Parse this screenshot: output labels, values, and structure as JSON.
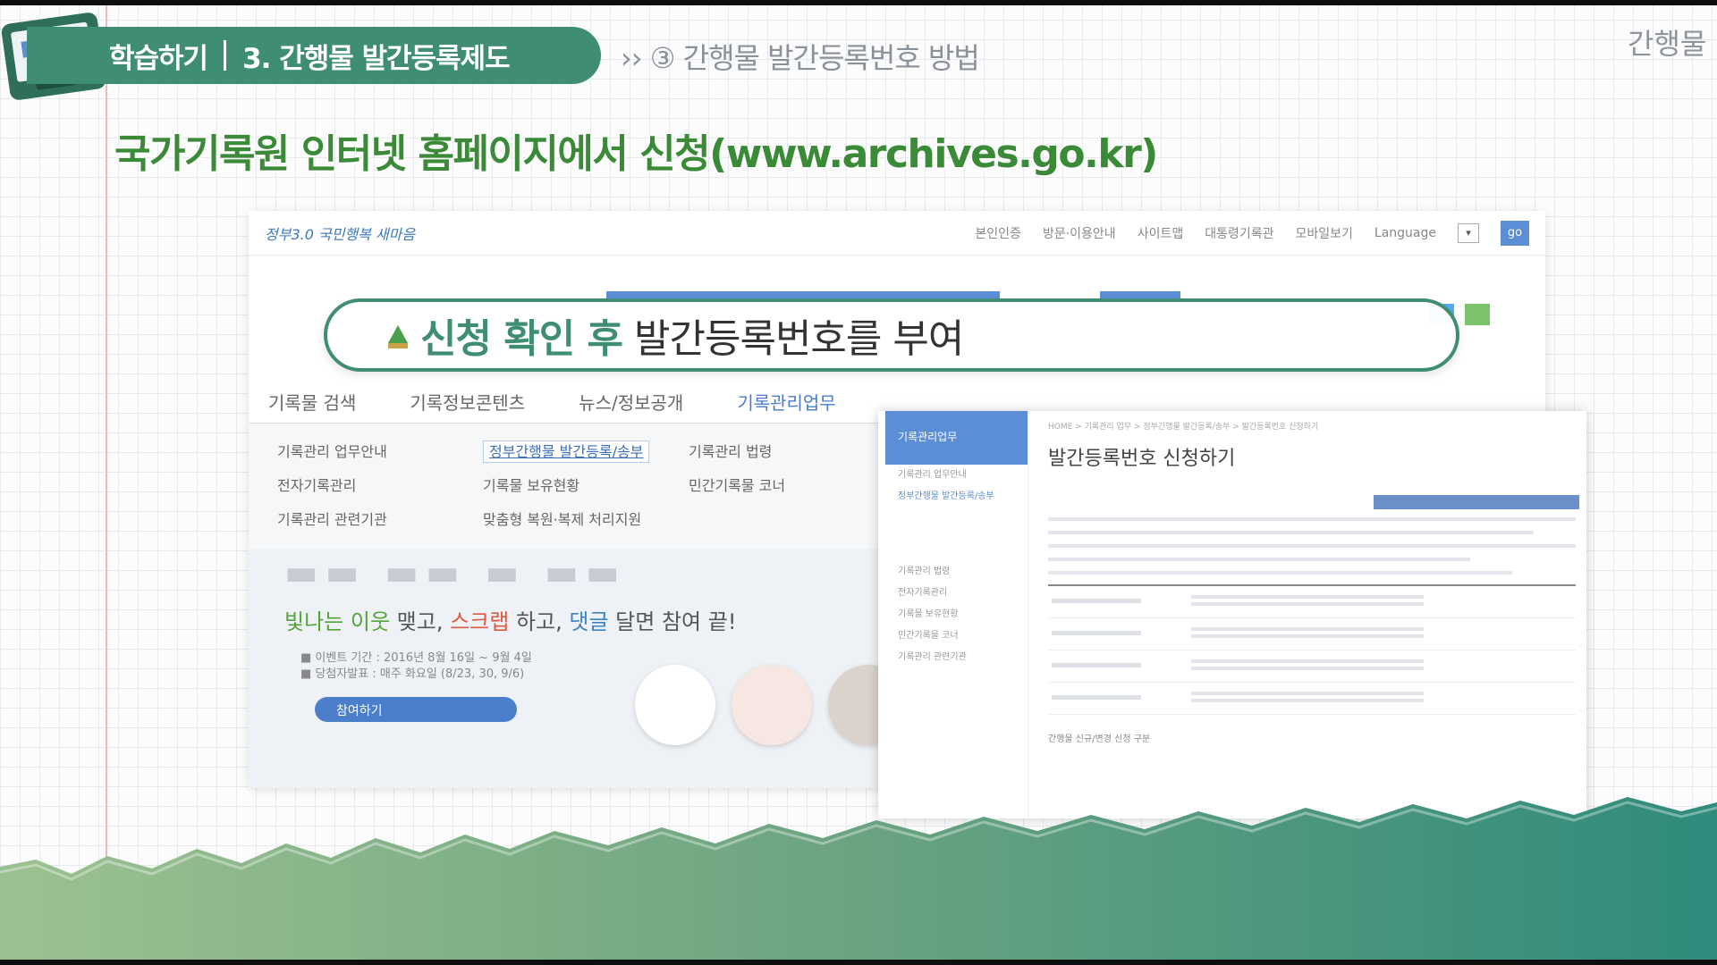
{
  "header": {
    "section": "학습하기",
    "chapter": "3. 간행물 발간등록제도",
    "breadcrumb": "›› ③ 간행물 발간등록번호 방법",
    "corner_label": "간행물"
  },
  "headline": "국가기록원 인터넷 홈페이지에서 신청(www.archives.go.kr)",
  "callout": {
    "emphasis": "신청 확인 후",
    "rest": " 발간등록번호를 부여"
  },
  "site": {
    "logo": "정부3.0 국민행복 새마음",
    "top_links": [
      "본인인증",
      "방문·이용안내",
      "사이트맵",
      "대통령기록관",
      "모바일보기",
      "Language"
    ],
    "go_label": "go",
    "nav": [
      "기록물 검색",
      "기록정보콘텐츠",
      "뉴스/정보공개",
      "기록관리업무"
    ],
    "submenu": [
      [
        "기록관리 업무안내",
        "정부간행물 발간등록/송부",
        "기록관리 법령"
      ],
      [
        "전자기록관리",
        "기록물 보유현황",
        "민간기록물 코너"
      ],
      [
        "기록관리 관련기관",
        "맞춤형 복원·복제 처리지원",
        ""
      ]
    ],
    "banner": {
      "slogan_g": "빛나는 이웃",
      "slogan_1": " 맺고, ",
      "slogan_r": "스크랩",
      "slogan_2": " 하고, ",
      "slogan_b": "댓글",
      "slogan_3": " 달면 참여 끝!",
      "period": "■ 이벤트 기간 : 2016년 8월 16일 ~ 9월 4일",
      "winner": "■ 당첨자발표 : 매주 화요일 (8/23, 30, 9/6)",
      "join": "참여하기"
    }
  },
  "overlay": {
    "sidebar_title": "기록관리업무",
    "sidebar_items": [
      "기록관리 업무안내",
      "정부간행물 발간등록/송부",
      "기록관리 법령",
      "전자기록관리",
      "기록물 보유현황",
      "민간기록물 코너",
      "기록관리 관련기관"
    ],
    "path": "HOME > 기록관리 업무 > 정부간행물 발간등록/송부 > 발간등록번호 신청하기",
    "title": "발간등록번호 신청하기",
    "footer": "간행물 신규/변경 신청 구분"
  },
  "colors": {
    "brand_green": "#3f8e73",
    "headline_green": "#3b8a38",
    "site_blue": "#5b8ed6"
  }
}
